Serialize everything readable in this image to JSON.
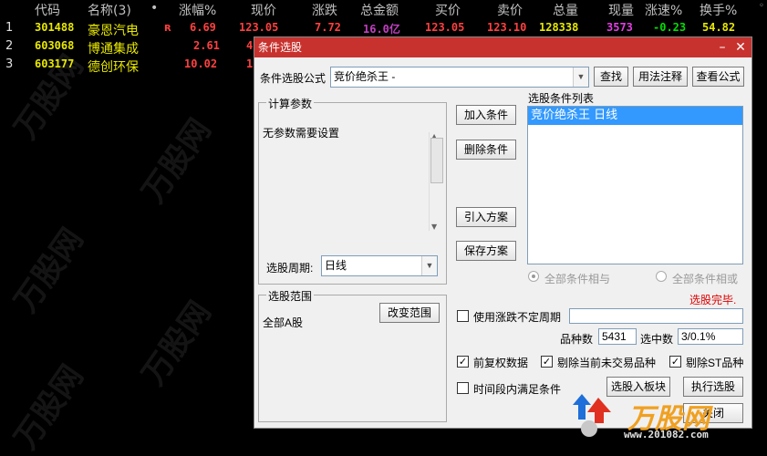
{
  "table": {
    "headers": [
      "代码",
      "名称(3)",
      "•",
      "涨幅%",
      "现价",
      "涨跌",
      "总金额",
      "买价",
      "卖价",
      "总量",
      "现量",
      "涨速%",
      "换手%"
    ],
    "rows": [
      {
        "idx": "1",
        "code": "301488",
        "name": "豪恩汽电",
        "flag": "R",
        "pct": "6.69",
        "price": "123.05",
        "change": "7.72",
        "amount": "16.0亿",
        "bid": "123.05",
        "ask": "123.10",
        "volume": "128338",
        "cur_vol": "3573",
        "speed": "-0.23",
        "turnover": "54.82"
      },
      {
        "idx": "2",
        "code": "603068",
        "name": "博通集成",
        "flag": "",
        "pct": "2.61",
        "price": "4",
        "change": "",
        "amount": "",
        "bid": "",
        "ask": "",
        "volume": "",
        "cur_vol": "",
        "speed": "",
        "turnover": ""
      },
      {
        "idx": "3",
        "code": "603177",
        "name": "德创环保",
        "flag": "",
        "pct": "10.02",
        "price": "1",
        "change": "",
        "amount": "",
        "bid": "",
        "ask": "",
        "volume": "",
        "cur_vol": "",
        "speed": "",
        "turnover": ""
      }
    ]
  },
  "dialog": {
    "title": "条件选股",
    "formula_label": "条件选股公式",
    "formula_value": "竞价绝杀王  -",
    "find_btn": "查找",
    "usage_btn": "用法注释",
    "view_btn": "查看公式",
    "params_group": "计算参数",
    "params_text": "无参数需要设置",
    "period_label": "选股周期:",
    "period_value": "日线",
    "add_btn": "加入条件",
    "del_btn": "删除条件",
    "import_btn": "引入方案",
    "save_btn": "保存方案",
    "cond_list_label": "选股条件列表",
    "cond_items": [
      "竞价绝杀王  日线"
    ],
    "radio_and": "全部条件相与",
    "radio_or": "全部条件相或",
    "status": "选股完毕.",
    "range_group": "选股范围",
    "range_value": "全部A股",
    "range_btn": "改变范围",
    "use_period_cb": "使用涨跌不定周期",
    "count_label": "品种数",
    "count_value": "5431",
    "selected_label": "选中数",
    "selected_value": "3/0.1%",
    "cb_fuquan": "前复权数据",
    "cb_untraded": "剔除当前未交易品种",
    "cb_st": "剔除ST品种",
    "cb_timerange": "时间段内满足条件",
    "to_block_btn": "选股入板块",
    "exec_btn": "执行选股",
    "close_btn": "关闭"
  },
  "watermark": {
    "text": "万股网",
    "url": "www.201082.com"
  },
  "colors": {
    "titlebar": "#c8322e",
    "accent_red": "#ff4040",
    "yellow": "#e8e800"
  }
}
